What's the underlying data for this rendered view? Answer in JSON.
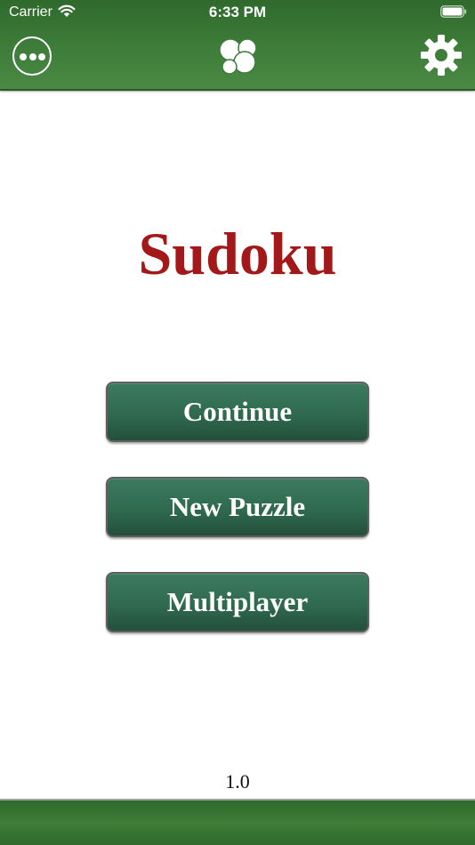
{
  "status_bar": {
    "carrier": "Carrier",
    "time": "6:33 PM",
    "wifi_icon": "wifi-icon",
    "battery_icon": "battery-icon"
  },
  "nav": {
    "more_icon": "ellipsis-circle-icon",
    "center_icon": "game-center-icon",
    "settings_icon": "gear-icon"
  },
  "title": "Sudoku",
  "buttons": {
    "continue": "Continue",
    "new_puzzle": "New Puzzle",
    "multiplayer": "Multiplayer"
  },
  "version": "1.0",
  "colors": {
    "bar_green": "#3e7d3a",
    "button_green": "#2f6a4f",
    "title_red": "#a31818"
  }
}
